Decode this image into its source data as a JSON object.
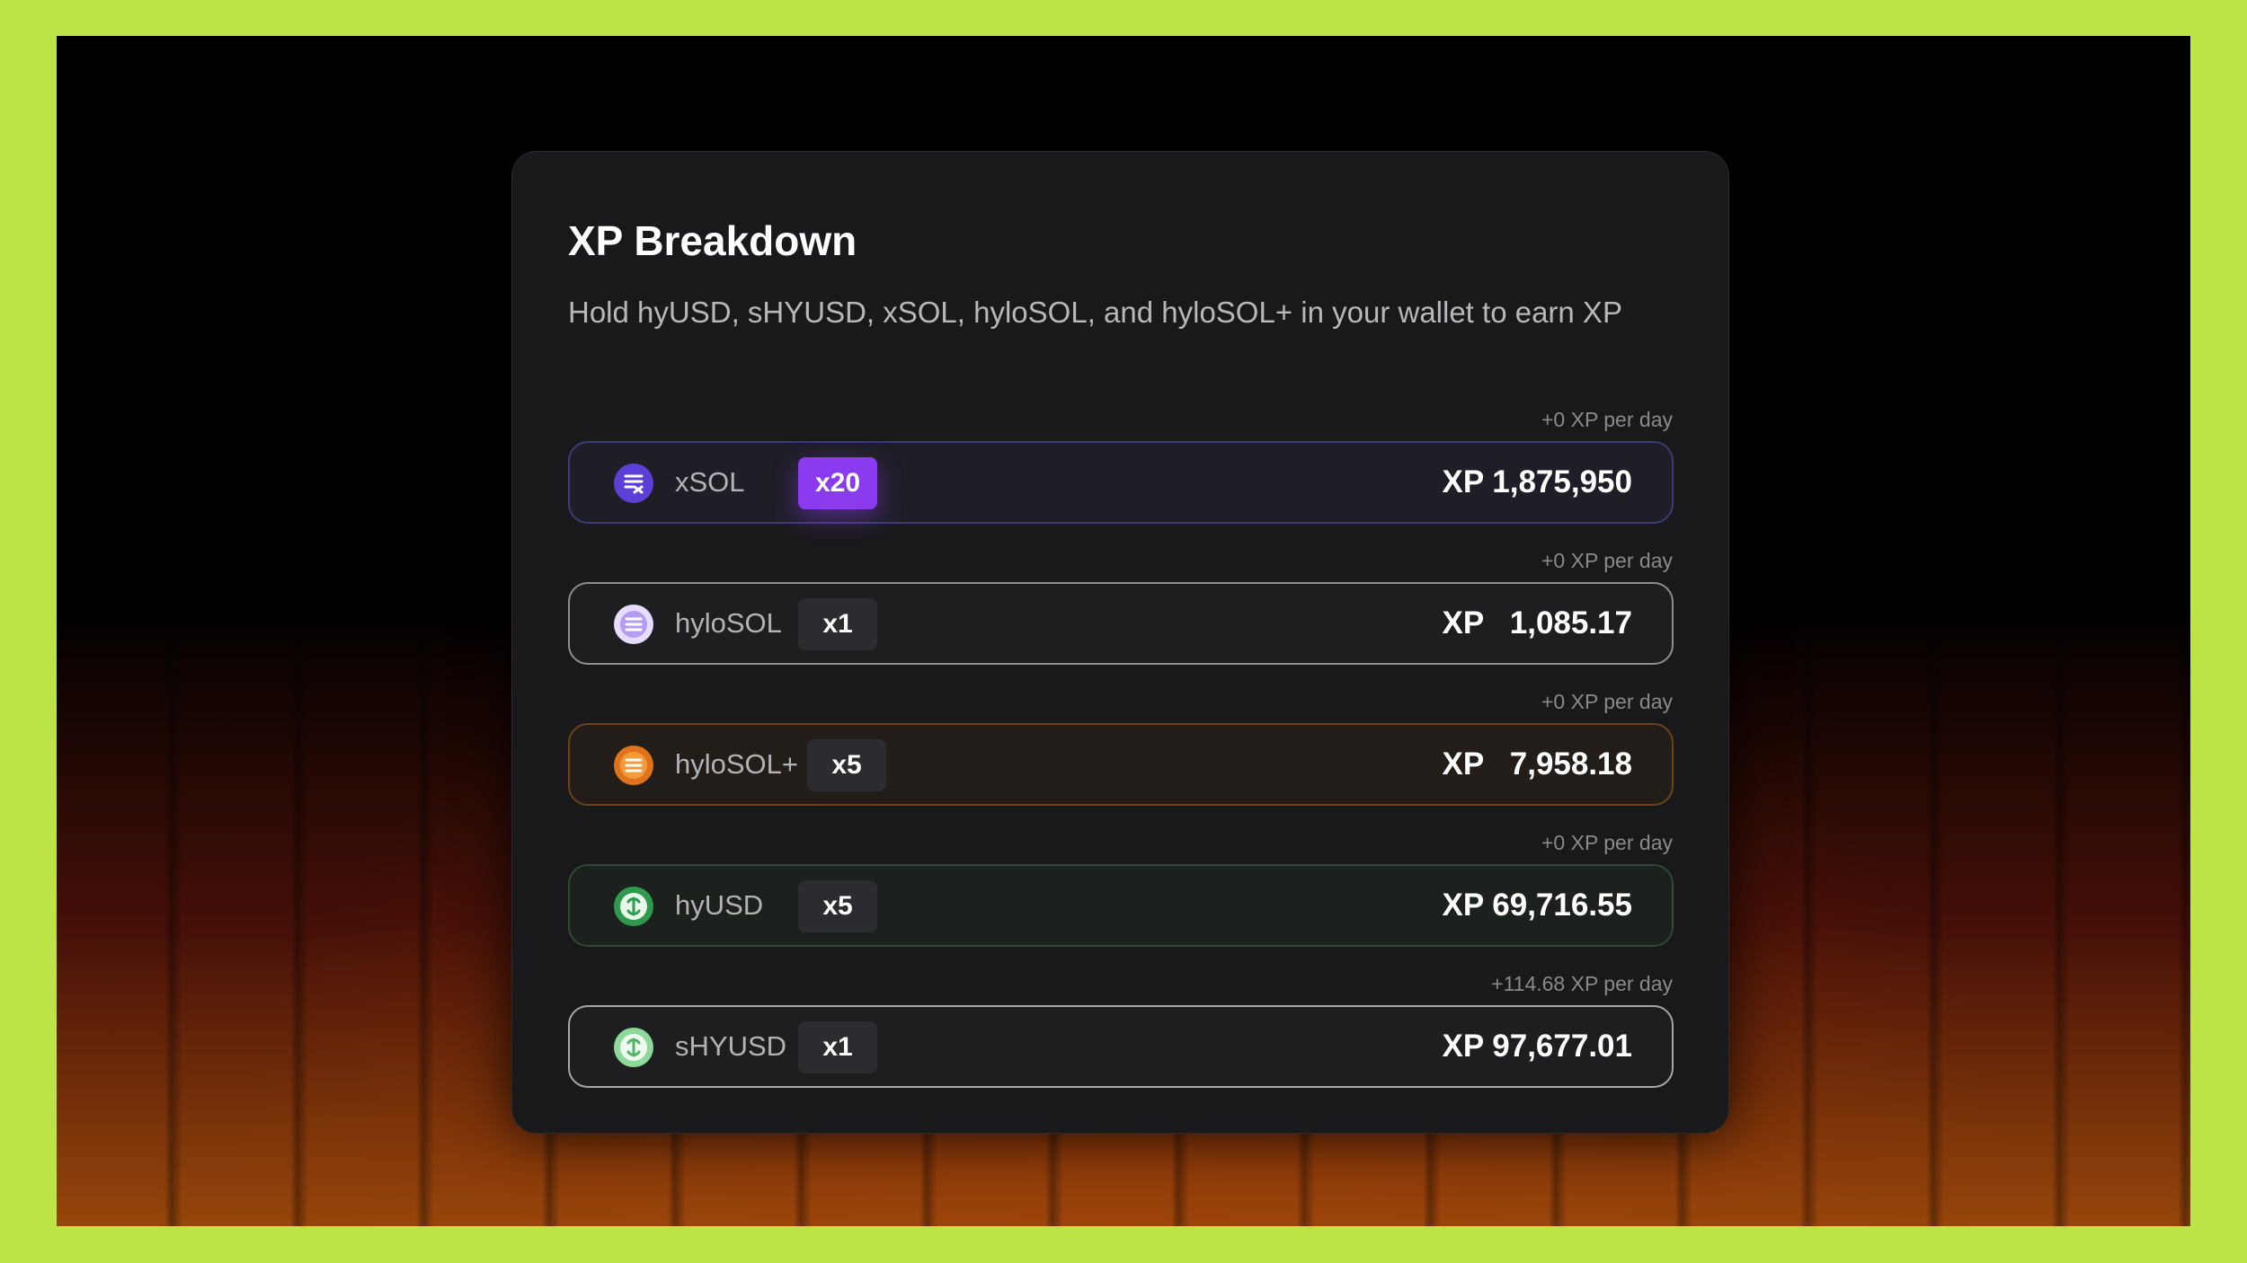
{
  "card": {
    "title": "XP Breakdown",
    "subtitle": "Hold hyUSD, sHYUSD, xSOL, hyloSOL, and hyloSOL+ in your wallet to earn XP"
  },
  "rows": [
    {
      "token": "xSOL",
      "multiplier": "x20",
      "per_day": "+0 XP per day",
      "xp_label": "XP",
      "xp_value": "1,875,950",
      "icon": "xsol-coin-icon",
      "color": "#5b3fd6"
    },
    {
      "token": "hyloSOL",
      "multiplier": "x1",
      "per_day": "+0 XP per day",
      "xp_label": "XP",
      "xp_value": "1,085.17",
      "icon": "hylosol-coin-icon",
      "color": "#d9c9ff"
    },
    {
      "token": "hyloSOL+",
      "multiplier": "x5",
      "per_day": "+0 XP per day",
      "xp_label": "XP",
      "xp_value": "7,958.18",
      "icon": "hylosol-plus-coin-icon",
      "color": "#e0741c"
    },
    {
      "token": "hyUSD",
      "multiplier": "x5",
      "per_day": "+0 XP per day",
      "xp_label": "XP",
      "xp_value": "69,716.55",
      "icon": "hyusd-coin-icon",
      "color": "#2f9a4e"
    },
    {
      "token": "sHYUSD",
      "multiplier": "x1",
      "per_day": "+114.68 XP per day",
      "xp_label": "XP",
      "xp_value": "97,677.01",
      "icon": "shyusd-coin-icon",
      "color": "#8ed99a"
    }
  ]
}
